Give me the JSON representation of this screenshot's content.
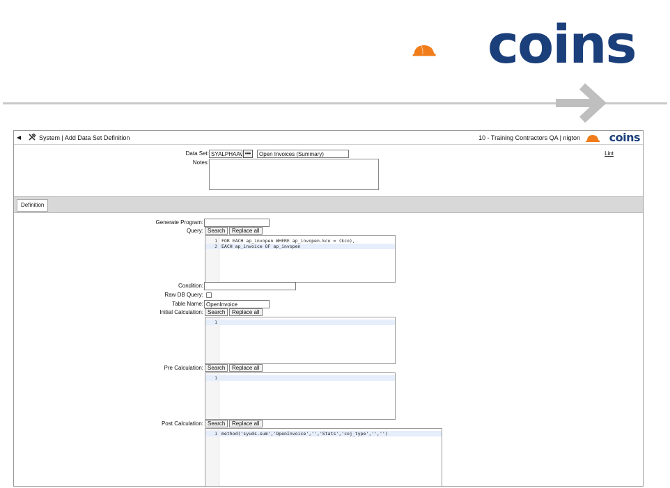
{
  "slide": {
    "brand_text": "coins",
    "brand_colors": {
      "helmet": "#f07d1a",
      "text": "#1b3f7a",
      "arrow": "#bfbfbf"
    }
  },
  "titlebar": {
    "breadcrumb": "System | Add Data Set Definition",
    "context": "10 - Training Contractors QA | nigton",
    "logo_text": "coins"
  },
  "header": {
    "data_set_label": "Data Set:",
    "data_set_code": "SYALPHAAVI",
    "data_set_name": "Open Invoices (Summary)",
    "notes_label": "Notes:",
    "lint_label": "Lint"
  },
  "tabs": [
    {
      "label": "Definition"
    }
  ],
  "form": {
    "generate_program_label": "Generate Program:",
    "query_label": "Query:",
    "search_label": "Search",
    "replace_all_label": "Replace all",
    "query_lines": [
      "FOR EACH ap_invopen WHERE ap_invopen.kco = (kco),",
      "EACH ap_invoice OF ap_invopen"
    ],
    "condition_label": "Condition:",
    "raw_db_query_label": "Raw DB Query:",
    "table_name_label": "Table Name:",
    "table_name_value": "OpenInvoice",
    "initial_calc_label": "Initial Calculation:",
    "pre_calc_label": "Pre Calculation:",
    "post_calc_label": "Post Calculation:",
    "post_calc_lines": [
      "method('syuds.sum','OpenInvoice','','Stats','coj_type','','')"
    ]
  }
}
